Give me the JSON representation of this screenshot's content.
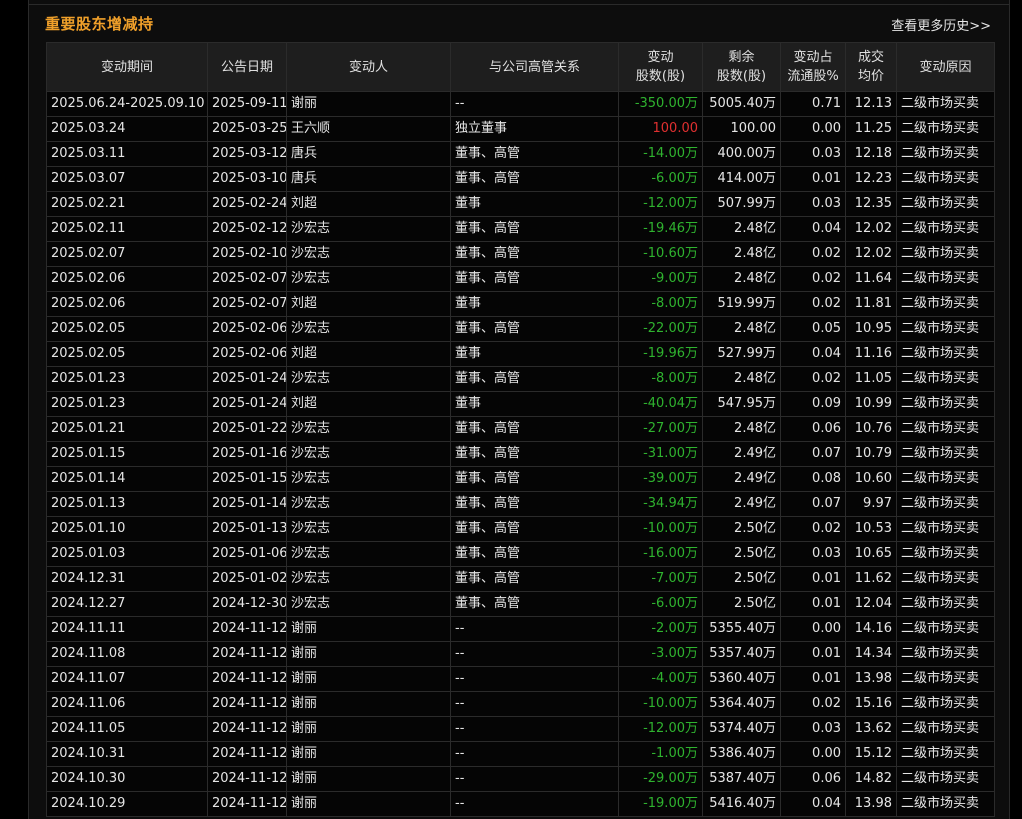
{
  "panel": {
    "title": "重要股东增减持",
    "more_link": "查看更多历史>>"
  },
  "colors": {
    "title": "#f0a02a",
    "increase": "#e03030",
    "decrease": "#2fb32f",
    "background": "#0d0d0d",
    "header_bg": "#1e1e1e"
  },
  "table": {
    "headers": [
      [
        "变动期间"
      ],
      [
        "公告日期"
      ],
      [
        "变动人"
      ],
      [
        "与公司高管关系"
      ],
      [
        "变动",
        "股数(股)"
      ],
      [
        "剩余",
        "股数(股)"
      ],
      [
        "变动占",
        "流通股%"
      ],
      [
        "成交",
        "均价"
      ],
      [
        "变动原因"
      ]
    ],
    "rows": [
      [
        "2025.06.24-2025.09.10",
        "2025-09-11",
        "谢丽",
        "--",
        "-350.00万",
        "5005.40万",
        "0.71",
        "12.13",
        "二级市场买卖"
      ],
      [
        "2025.03.24",
        "2025-03-25",
        "王六顺",
        "独立董事",
        "100.00",
        "100.00",
        "0.00",
        "11.25",
        "二级市场买卖"
      ],
      [
        "2025.03.11",
        "2025-03-12",
        "唐兵",
        "董事、高管",
        "-14.00万",
        "400.00万",
        "0.03",
        "12.18",
        "二级市场买卖"
      ],
      [
        "2025.03.07",
        "2025-03-10",
        "唐兵",
        "董事、高管",
        "-6.00万",
        "414.00万",
        "0.01",
        "12.23",
        "二级市场买卖"
      ],
      [
        "2025.02.21",
        "2025-02-24",
        "刘超",
        "董事",
        "-12.00万",
        "507.99万",
        "0.03",
        "12.35",
        "二级市场买卖"
      ],
      [
        "2025.02.11",
        "2025-02-12",
        "沙宏志",
        "董事、高管",
        "-19.46万",
        "2.48亿",
        "0.04",
        "12.02",
        "二级市场买卖"
      ],
      [
        "2025.02.07",
        "2025-02-10",
        "沙宏志",
        "董事、高管",
        "-10.60万",
        "2.48亿",
        "0.02",
        "12.02",
        "二级市场买卖"
      ],
      [
        "2025.02.06",
        "2025-02-07",
        "沙宏志",
        "董事、高管",
        "-9.00万",
        "2.48亿",
        "0.02",
        "11.64",
        "二级市场买卖"
      ],
      [
        "2025.02.06",
        "2025-02-07",
        "刘超",
        "董事",
        "-8.00万",
        "519.99万",
        "0.02",
        "11.81",
        "二级市场买卖"
      ],
      [
        "2025.02.05",
        "2025-02-06",
        "沙宏志",
        "董事、高管",
        "-22.00万",
        "2.48亿",
        "0.05",
        "10.95",
        "二级市场买卖"
      ],
      [
        "2025.02.05",
        "2025-02-06",
        "刘超",
        "董事",
        "-19.96万",
        "527.99万",
        "0.04",
        "11.16",
        "二级市场买卖"
      ],
      [
        "2025.01.23",
        "2025-01-24",
        "沙宏志",
        "董事、高管",
        "-8.00万",
        "2.48亿",
        "0.02",
        "11.05",
        "二级市场买卖"
      ],
      [
        "2025.01.23",
        "2025-01-24",
        "刘超",
        "董事",
        "-40.04万",
        "547.95万",
        "0.09",
        "10.99",
        "二级市场买卖"
      ],
      [
        "2025.01.21",
        "2025-01-22",
        "沙宏志",
        "董事、高管",
        "-27.00万",
        "2.48亿",
        "0.06",
        "10.76",
        "二级市场买卖"
      ],
      [
        "2025.01.15",
        "2025-01-16",
        "沙宏志",
        "董事、高管",
        "-31.00万",
        "2.49亿",
        "0.07",
        "10.79",
        "二级市场买卖"
      ],
      [
        "2025.01.14",
        "2025-01-15",
        "沙宏志",
        "董事、高管",
        "-39.00万",
        "2.49亿",
        "0.08",
        "10.60",
        "二级市场买卖"
      ],
      [
        "2025.01.13",
        "2025-01-14",
        "沙宏志",
        "董事、高管",
        "-34.94万",
        "2.49亿",
        "0.07",
        "9.97",
        "二级市场买卖"
      ],
      [
        "2025.01.10",
        "2025-01-13",
        "沙宏志",
        "董事、高管",
        "-10.00万",
        "2.50亿",
        "0.02",
        "10.53",
        "二级市场买卖"
      ],
      [
        "2025.01.03",
        "2025-01-06",
        "沙宏志",
        "董事、高管",
        "-16.00万",
        "2.50亿",
        "0.03",
        "10.65",
        "二级市场买卖"
      ],
      [
        "2024.12.31",
        "2025-01-02",
        "沙宏志",
        "董事、高管",
        "-7.00万",
        "2.50亿",
        "0.01",
        "11.62",
        "二级市场买卖"
      ],
      [
        "2024.12.27",
        "2024-12-30",
        "沙宏志",
        "董事、高管",
        "-6.00万",
        "2.50亿",
        "0.01",
        "12.04",
        "二级市场买卖"
      ],
      [
        "2024.11.11",
        "2024-11-12",
        "谢丽",
        "--",
        "-2.00万",
        "5355.40万",
        "0.00",
        "14.16",
        "二级市场买卖"
      ],
      [
        "2024.11.08",
        "2024-11-12",
        "谢丽",
        "--",
        "-3.00万",
        "5357.40万",
        "0.01",
        "14.34",
        "二级市场买卖"
      ],
      [
        "2024.11.07",
        "2024-11-12",
        "谢丽",
        "--",
        "-4.00万",
        "5360.40万",
        "0.01",
        "13.98",
        "二级市场买卖"
      ],
      [
        "2024.11.06",
        "2024-11-12",
        "谢丽",
        "--",
        "-10.00万",
        "5364.40万",
        "0.02",
        "15.16",
        "二级市场买卖"
      ],
      [
        "2024.11.05",
        "2024-11-12",
        "谢丽",
        "--",
        "-12.00万",
        "5374.40万",
        "0.03",
        "13.62",
        "二级市场买卖"
      ],
      [
        "2024.10.31",
        "2024-11-12",
        "谢丽",
        "--",
        "-1.00万",
        "5386.40万",
        "0.00",
        "15.12",
        "二级市场买卖"
      ],
      [
        "2024.10.30",
        "2024-11-12",
        "谢丽",
        "--",
        "-29.00万",
        "5387.40万",
        "0.06",
        "14.82",
        "二级市场买卖"
      ],
      [
        "2024.10.29",
        "2024-11-12",
        "谢丽",
        "--",
        "-19.00万",
        "5416.40万",
        "0.04",
        "13.98",
        "二级市场买卖"
      ]
    ]
  }
}
